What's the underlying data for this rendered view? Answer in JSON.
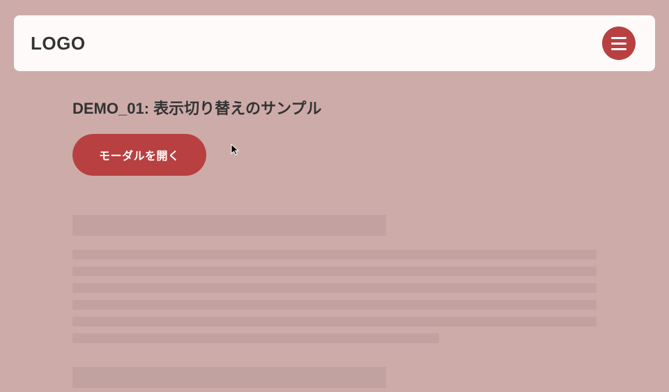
{
  "header": {
    "logo": "LOGO",
    "menu_icon_name": "hamburger-icon"
  },
  "main": {
    "title": "DEMO_01: 表示切り替えのサンプル",
    "open_modal_label": "モーダルを開く"
  },
  "colors": {
    "background": "#cdaba9",
    "header_bg": "#fdfaf9",
    "accent": "#b84040",
    "skeleton": "#c2a2a0",
    "text": "#333333"
  }
}
